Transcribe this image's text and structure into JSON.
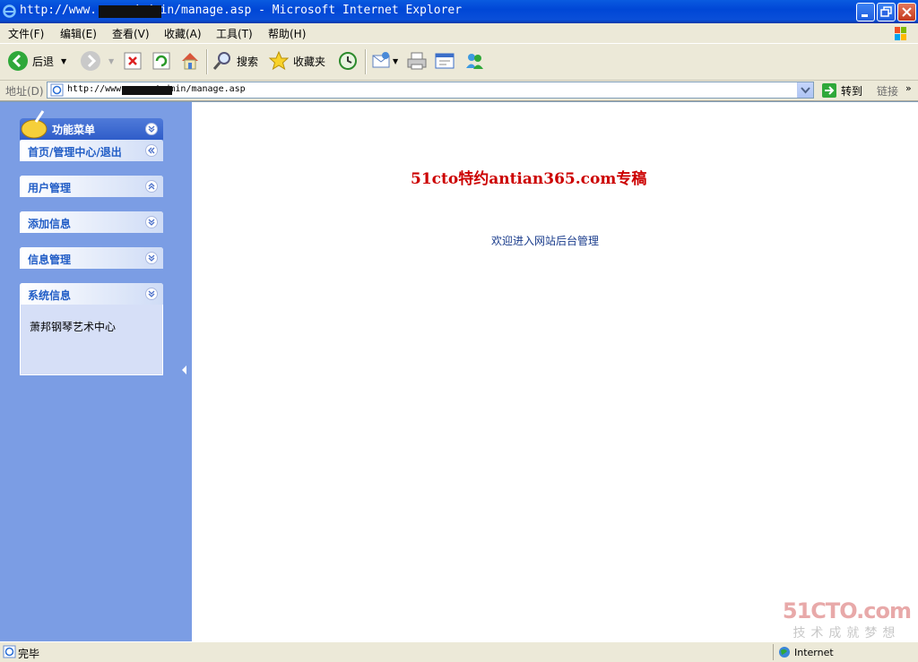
{
  "window": {
    "title": "http://www.          .com/admin/manage.asp - Microsoft Internet Explorer"
  },
  "menubar": {
    "items": [
      "文件(F)",
      "编辑(E)",
      "查看(V)",
      "收藏(A)",
      "工具(T)",
      "帮助(H)"
    ]
  },
  "toolbar": {
    "back_label": "后退",
    "search_label": "搜索",
    "favorites_label": "收藏夹"
  },
  "address": {
    "label": "地址(D)",
    "url": "http://www.          .com/admin/manage.asp",
    "go_label": "转到",
    "links_label": "链接"
  },
  "sidebar": {
    "header": "功能菜单",
    "panels": [
      {
        "title": "首页/管理中心/退出"
      },
      {
        "title": "用户管理"
      },
      {
        "title": "添加信息"
      },
      {
        "title": "信息管理"
      },
      {
        "title": "系统信息",
        "body": "萧邦钢琴艺术中心"
      }
    ]
  },
  "main": {
    "heading": "51cto特约antian365.com专稿",
    "welcome": "欢迎进入网站后台管理"
  },
  "watermark": {
    "logo": "51CTO.com",
    "slogan": "技术成就梦想"
  },
  "statusbar": {
    "text": "完毕",
    "zone": "Internet"
  },
  "colors": {
    "sidebar_bg": "#7b9de4",
    "heading_red": "#cc0000",
    "panel_title_blue": "#215dc6"
  }
}
